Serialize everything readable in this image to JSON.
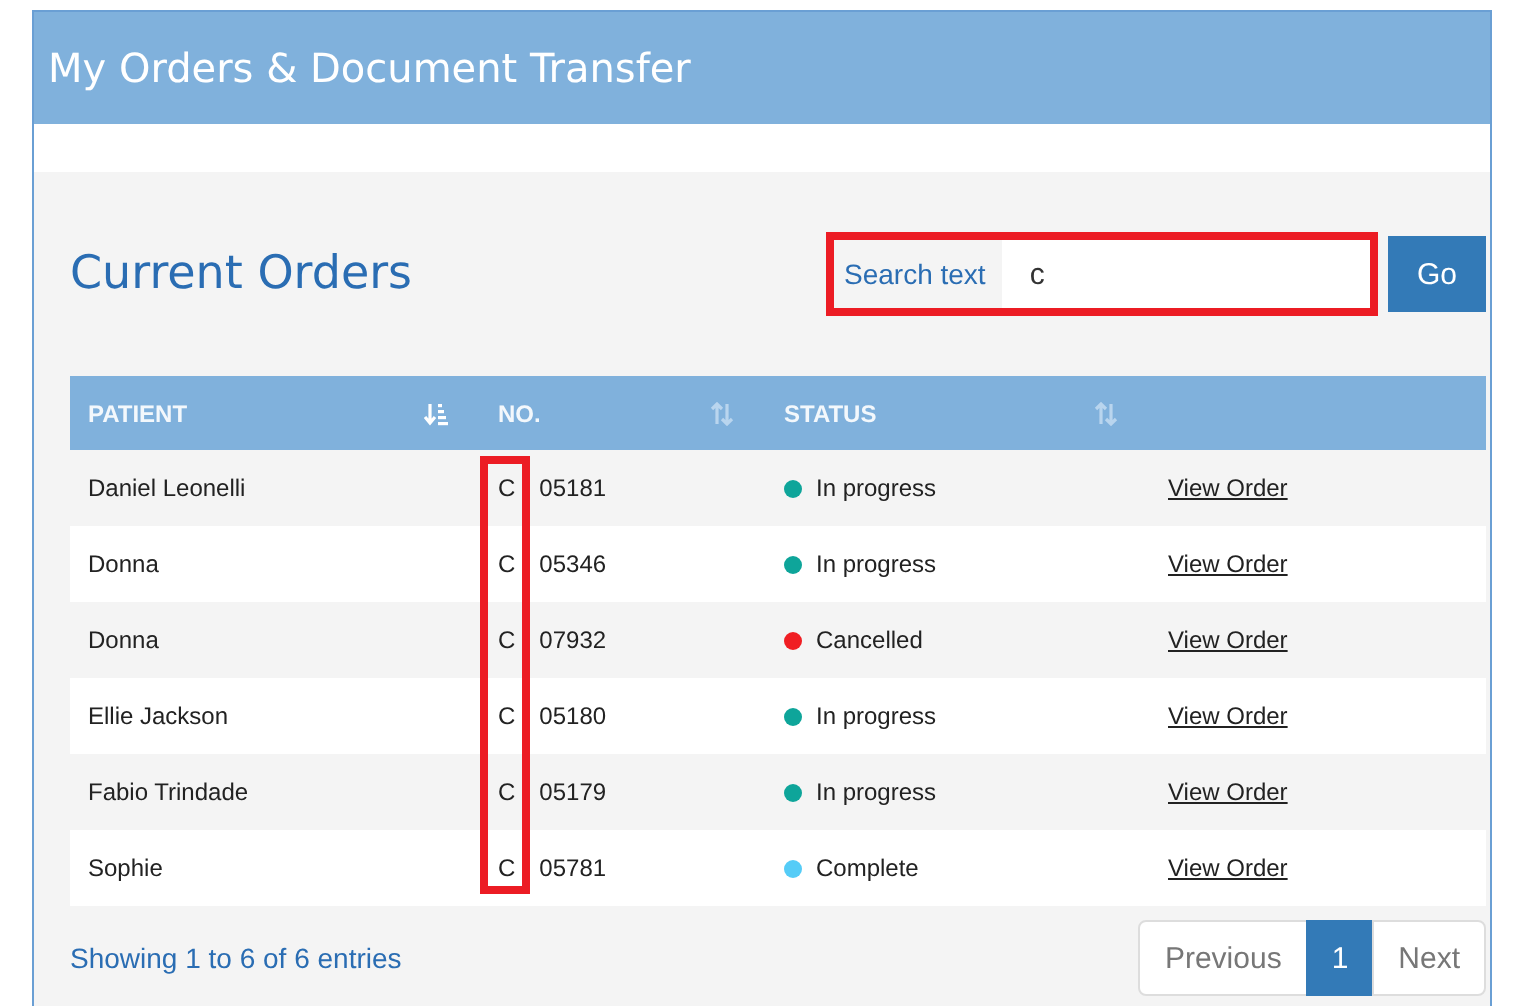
{
  "window": {
    "title": "My Orders & Document Transfer"
  },
  "heading": "Current Orders",
  "search": {
    "label": "Search text",
    "value": "c",
    "highlighted": true,
    "button": "Go"
  },
  "table": {
    "columns": [
      {
        "label": "PATIENT",
        "sorted": true,
        "highlighted": false
      },
      {
        "label": "NO.",
        "sorted": false,
        "highlighted": true
      },
      {
        "label": "STATUS",
        "sorted": false,
        "highlighted": false
      }
    ],
    "rows": [
      {
        "patient": "Daniel Leonelli",
        "number": [
          "C",
          "05181"
        ],
        "status": "In progress",
        "color": "#0ea59a",
        "link": "View Order"
      },
      {
        "patient": "Donna",
        "number": [
          "C",
          "05346"
        ],
        "status": "In progress",
        "color": "#0ea59a",
        "link": "View Order"
      },
      {
        "patient": "Donna",
        "number": [
          "C",
          "07932"
        ],
        "status": "Cancelled",
        "color": "#f01e23",
        "link": "View Order"
      },
      {
        "patient": "Ellie Jackson",
        "number": [
          "C",
          "05180"
        ],
        "status": "In progress",
        "color": "#0ea59a",
        "link": "View Order"
      },
      {
        "patient": "Fabio Trindade",
        "number": [
          "C",
          "05179"
        ],
        "status": "In progress",
        "color": "#0ea59a",
        "link": "View Order"
      },
      {
        "patient": "Sophie",
        "number": [
          "C",
          "05781"
        ],
        "status": "Complete",
        "color": "#55ccf7",
        "link": "View Order"
      }
    ]
  },
  "footer": {
    "info": "Showing 1 to 6 of 6 entries",
    "pagination": [
      {
        "label": "Previous",
        "selected": false
      },
      {
        "label": "1",
        "selected": true
      },
      {
        "label": "Next",
        "selected": false
      }
    ]
  }
}
